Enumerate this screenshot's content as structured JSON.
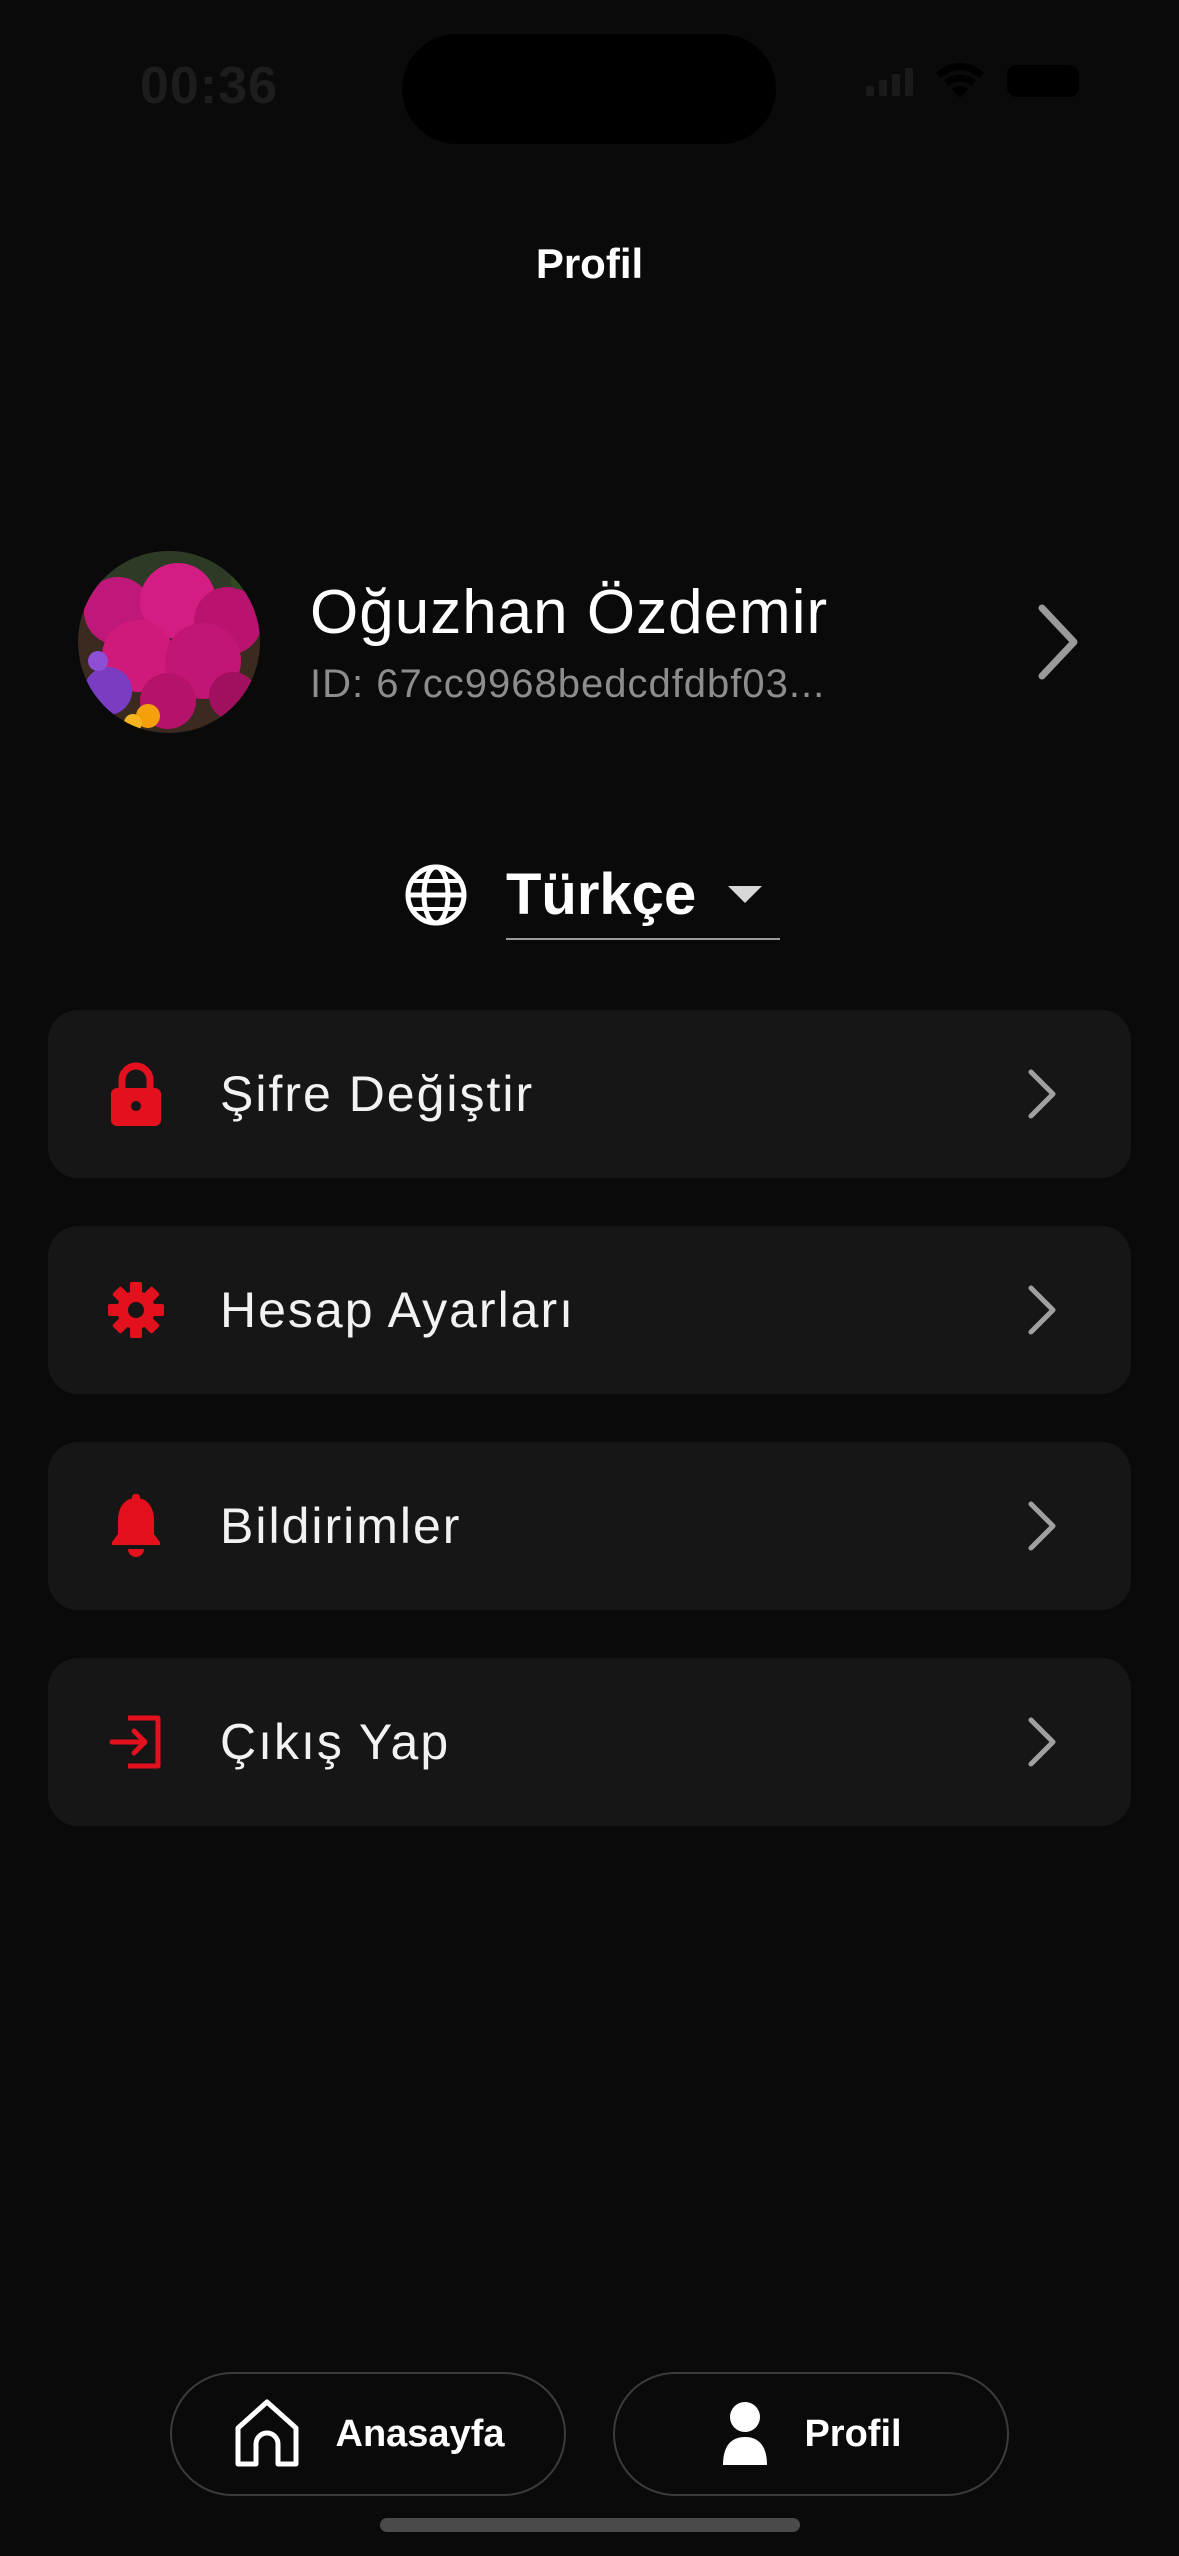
{
  "status_bar": {
    "time": "00:36"
  },
  "header": {
    "title": "Profil"
  },
  "profile": {
    "name": "Oğuzhan Özdemir",
    "id_text": "ID: 67cc9968bedcdfdbf03..."
  },
  "language": {
    "selected": "Türkçe"
  },
  "menu": {
    "items": [
      {
        "label": "Şifre Değiştir",
        "icon": "lock-icon"
      },
      {
        "label": "Hesap Ayarları",
        "icon": "gear-icon"
      },
      {
        "label": "Bildirimler",
        "icon": "bell-icon"
      },
      {
        "label": "Çıkış Yap",
        "icon": "logout-icon"
      }
    ]
  },
  "bottom_nav": {
    "home_label": "Anasayfa",
    "profile_label": "Profil"
  },
  "colors": {
    "accent": "#e3101d",
    "background": "#0a0a0a",
    "card": "#161616"
  }
}
